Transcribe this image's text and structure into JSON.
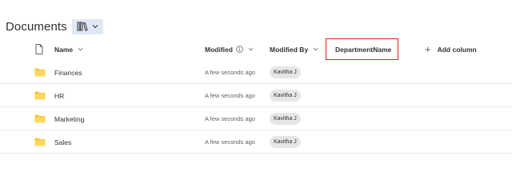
{
  "library": {
    "title": "Documents",
    "view_icon": "library-view-icon",
    "view_chevron": "chevron-down-icon"
  },
  "columns": {
    "file_type_icon": "document-icon",
    "name": "Name",
    "modified": "Modified",
    "modified_info_icon": "info-icon",
    "modified_by": "Modified By",
    "department_name": "DepartmentName",
    "add_column": "Add column",
    "add_column_icon": "plus-icon",
    "highlight_color": "#e01e23"
  },
  "rows": [
    {
      "name": "Finances",
      "modified": "A few seconds ago",
      "modified_by": "Kavitha J",
      "icon": "folder-icon"
    },
    {
      "name": "HR",
      "modified": "A few seconds ago",
      "modified_by": "Kavitha J",
      "icon": "folder-icon"
    },
    {
      "name": "Marketing",
      "modified": "A few seconds ago",
      "modified_by": "Kavitha J",
      "icon": "folder-icon"
    },
    {
      "name": "Sales",
      "modified": "A few seconds ago",
      "modified_by": "Kavitha J",
      "icon": "folder-icon"
    }
  ]
}
